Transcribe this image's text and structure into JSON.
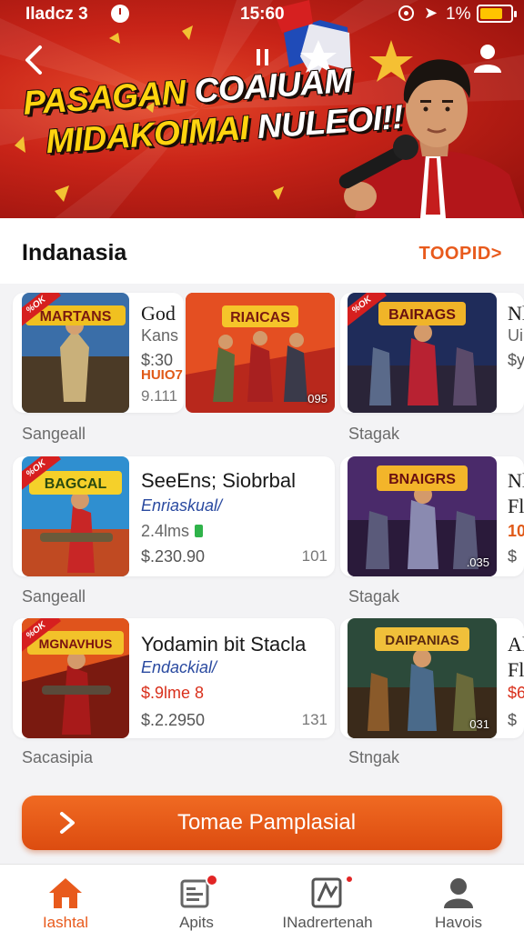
{
  "status_bar": {
    "carrier": "Iladcz 3",
    "time": "15:60",
    "battery": "1%"
  },
  "banner": {
    "headline_line1_a": "PASAGAN",
    "headline_line1_b": "COAIUAM",
    "headline_line2_a": "MIDAKOIMAI",
    "headline_line2_b": "NULEOI!!",
    "icons": [
      "back-arrow-icon",
      "pause-icon",
      "profile-icon"
    ]
  },
  "section": {
    "title": "Indanasia",
    "see_more": "TOOPID>"
  },
  "games": {
    "r1c1": {
      "thumb_title": "MARTANS",
      "tag": "%OK",
      "title": "God",
      "line2": "Kans",
      "price": "$:30",
      "line4": "HUIO7",
      "count": "9.111"
    },
    "r1c2": {
      "thumb_title": "RIAICAS",
      "count": "095"
    },
    "r1c3": {
      "thumb_title": "BAIRAGS",
      "tag": "%OK",
      "title": "Nl",
      "line2": "Ui",
      "line3": "$y"
    },
    "r2c1": {
      "thumb_title": "BAGCAL",
      "tag": "%OK",
      "title": "SeeEns; Siobrbal",
      "sub": "Enriaskual/",
      "meta": "2.4lms",
      "price": "$.230.90",
      "count": "101"
    },
    "r2c2": {
      "thumb_title": "BNAIGRS",
      "count": ".035",
      "title": "Nl",
      "line2": "Fl",
      "line3": "10",
      "line4": "$"
    },
    "r3c1": {
      "thumb_title": "MGNAVHUS",
      "tag": "%OK",
      "title": "Yodamin bit Stacla",
      "sub": "Endackial/",
      "meta": "$.9lme 8",
      "price": "$.2.2950",
      "count": "131"
    },
    "r3c2": {
      "thumb_title": "DAIPANIAS",
      "count": "031",
      "title": "Al",
      "line2": "Fl",
      "line3": "$6",
      "line4": "$"
    }
  },
  "row_labels": {
    "r1_left": "Sangeall",
    "r1_right": "Stagak",
    "r2_left": "Sangeall",
    "r2_right": "Stagak",
    "r3_left": "Sacasipia",
    "r3_right": "Stngak"
  },
  "cta": {
    "label": "Tomae Pamplasial"
  },
  "bottom_nav": [
    {
      "label": "Iashtal",
      "icon": "home-icon",
      "active": true
    },
    {
      "label": "Apits",
      "icon": "apps-icon",
      "active": false
    },
    {
      "label": "INadrertenah",
      "icon": "news-icon",
      "active": false
    },
    {
      "label": "Havois",
      "icon": "person-icon",
      "active": false
    }
  ],
  "colors": {
    "accent": "#e85a1c",
    "banner_red": "#c92418",
    "headline_yellow": "#ffd40f"
  }
}
